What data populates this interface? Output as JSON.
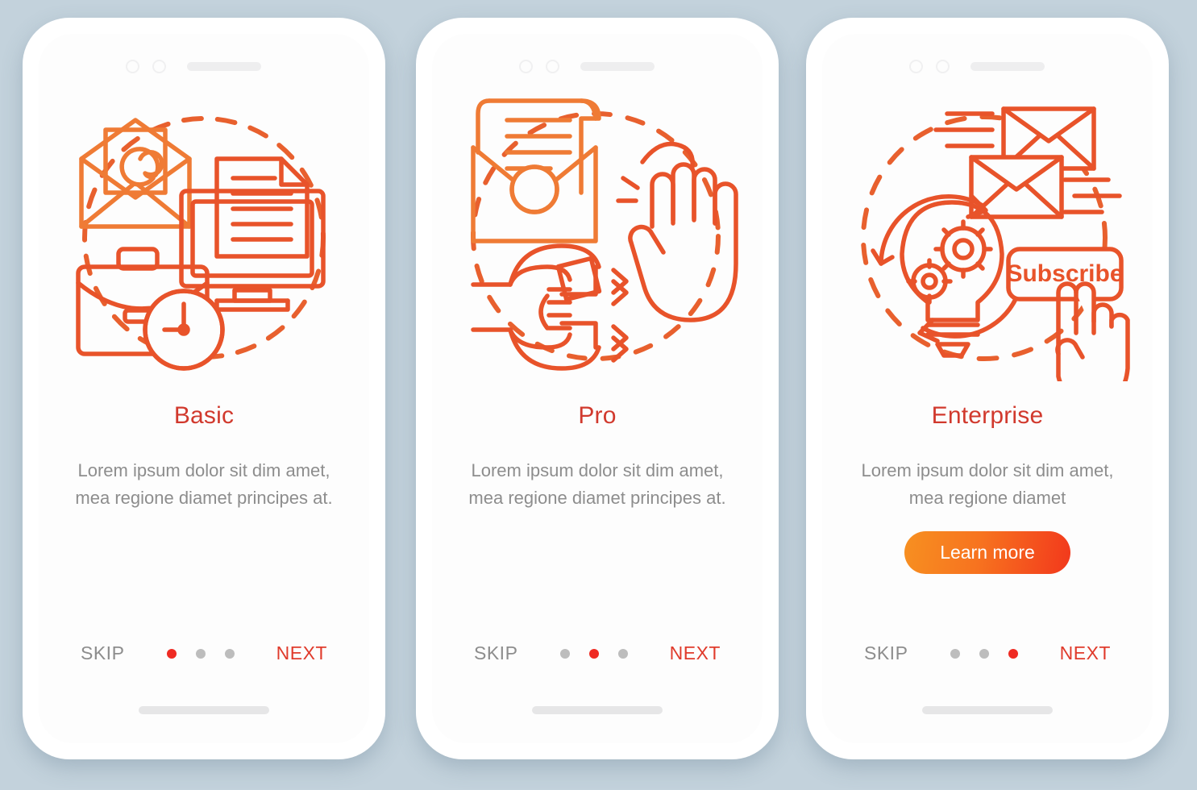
{
  "background_color": "#c3d2dc",
  "palette": {
    "title_red": "#d1392d",
    "next_red": "#e03b2c",
    "dot_active": "#ef2b23",
    "dot_inactive": "#bdbdbd",
    "body_gray": "#8d8d8d",
    "illustration_orange": "#f08a33",
    "illustration_red_orange": "#e8532a",
    "cta_gradient_from": "#f79021",
    "cta_gradient_to": "#f2381c"
  },
  "screens": [
    {
      "id": "basic",
      "title": "Basic",
      "description": "Lorem ipsum dolor sit dim amet, mea regione diamet principes at.",
      "illustration_name": "email-document-briefcase-illustration",
      "illustration_items": [
        "envelope-at-icon",
        "monitor-document-icon",
        "briefcase-clock-icon",
        "dashed-circle"
      ],
      "cta": null,
      "skip_label": "SKIP",
      "next_label": "NEXT",
      "dots": [
        true,
        false,
        false
      ]
    },
    {
      "id": "pro",
      "title": "Pro",
      "description": "Lorem ipsum dolor sit dim amet, mea regione diamet principes at.",
      "illustration_name": "letter-magnet-hand-illustration",
      "illustration_items": [
        "open-envelope-letter-icon",
        "magnet-icon",
        "raised-hand-icon",
        "dashed-circle"
      ],
      "cta": null,
      "skip_label": "SKIP",
      "next_label": "NEXT",
      "dots": [
        false,
        true,
        false
      ]
    },
    {
      "id": "enterprise",
      "title": "Enterprise",
      "description": "Lorem ipsum dolor sit dim amet, mea regione diamet",
      "illustration_name": "lightbulb-subscribe-illustration",
      "illustration_items": [
        "envelopes-speedlines-icon",
        "lightbulb-gears-icon",
        "subscribe-button-icon",
        "pointing-hand-icon",
        "dashed-circle"
      ],
      "illustration_button_label": "Subscribe",
      "cta": "Learn more",
      "skip_label": "SKIP",
      "next_label": "NEXT",
      "dots": [
        false,
        false,
        true
      ]
    }
  ]
}
